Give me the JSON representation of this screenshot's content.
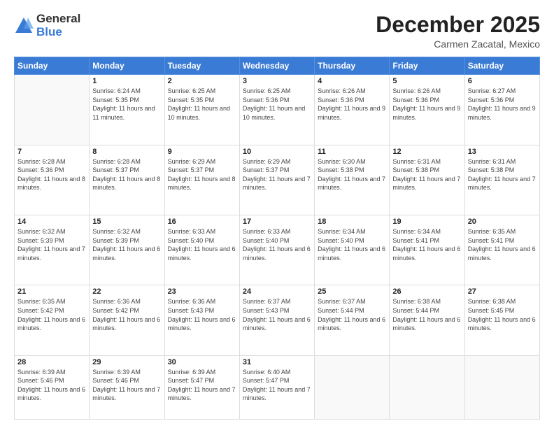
{
  "header": {
    "logo_general": "General",
    "logo_blue": "Blue",
    "main_title": "December 2025",
    "subtitle": "Carmen Zacatal, Mexico"
  },
  "days_of_week": [
    "Sunday",
    "Monday",
    "Tuesday",
    "Wednesday",
    "Thursday",
    "Friday",
    "Saturday"
  ],
  "weeks": [
    [
      {
        "day": "",
        "content": ""
      },
      {
        "day": "1",
        "content": "Sunrise: 6:24 AM\nSunset: 5:35 PM\nDaylight: 11 hours and 11 minutes."
      },
      {
        "day": "2",
        "content": "Sunrise: 6:25 AM\nSunset: 5:35 PM\nDaylight: 11 hours and 10 minutes."
      },
      {
        "day": "3",
        "content": "Sunrise: 6:25 AM\nSunset: 5:36 PM\nDaylight: 11 hours and 10 minutes."
      },
      {
        "day": "4",
        "content": "Sunrise: 6:26 AM\nSunset: 5:36 PM\nDaylight: 11 hours and 9 minutes."
      },
      {
        "day": "5",
        "content": "Sunrise: 6:26 AM\nSunset: 5:36 PM\nDaylight: 11 hours and 9 minutes."
      },
      {
        "day": "6",
        "content": "Sunrise: 6:27 AM\nSunset: 5:36 PM\nDaylight: 11 hours and 9 minutes."
      }
    ],
    [
      {
        "day": "7",
        "content": "Sunrise: 6:28 AM\nSunset: 5:36 PM\nDaylight: 11 hours and 8 minutes."
      },
      {
        "day": "8",
        "content": "Sunrise: 6:28 AM\nSunset: 5:37 PM\nDaylight: 11 hours and 8 minutes."
      },
      {
        "day": "9",
        "content": "Sunrise: 6:29 AM\nSunset: 5:37 PM\nDaylight: 11 hours and 8 minutes."
      },
      {
        "day": "10",
        "content": "Sunrise: 6:29 AM\nSunset: 5:37 PM\nDaylight: 11 hours and 7 minutes."
      },
      {
        "day": "11",
        "content": "Sunrise: 6:30 AM\nSunset: 5:38 PM\nDaylight: 11 hours and 7 minutes."
      },
      {
        "day": "12",
        "content": "Sunrise: 6:31 AM\nSunset: 5:38 PM\nDaylight: 11 hours and 7 minutes."
      },
      {
        "day": "13",
        "content": "Sunrise: 6:31 AM\nSunset: 5:38 PM\nDaylight: 11 hours and 7 minutes."
      }
    ],
    [
      {
        "day": "14",
        "content": "Sunrise: 6:32 AM\nSunset: 5:39 PM\nDaylight: 11 hours and 7 minutes."
      },
      {
        "day": "15",
        "content": "Sunrise: 6:32 AM\nSunset: 5:39 PM\nDaylight: 11 hours and 6 minutes."
      },
      {
        "day": "16",
        "content": "Sunrise: 6:33 AM\nSunset: 5:40 PM\nDaylight: 11 hours and 6 minutes."
      },
      {
        "day": "17",
        "content": "Sunrise: 6:33 AM\nSunset: 5:40 PM\nDaylight: 11 hours and 6 minutes."
      },
      {
        "day": "18",
        "content": "Sunrise: 6:34 AM\nSunset: 5:40 PM\nDaylight: 11 hours and 6 minutes."
      },
      {
        "day": "19",
        "content": "Sunrise: 6:34 AM\nSunset: 5:41 PM\nDaylight: 11 hours and 6 minutes."
      },
      {
        "day": "20",
        "content": "Sunrise: 6:35 AM\nSunset: 5:41 PM\nDaylight: 11 hours and 6 minutes."
      }
    ],
    [
      {
        "day": "21",
        "content": "Sunrise: 6:35 AM\nSunset: 5:42 PM\nDaylight: 11 hours and 6 minutes."
      },
      {
        "day": "22",
        "content": "Sunrise: 6:36 AM\nSunset: 5:42 PM\nDaylight: 11 hours and 6 minutes."
      },
      {
        "day": "23",
        "content": "Sunrise: 6:36 AM\nSunset: 5:43 PM\nDaylight: 11 hours and 6 minutes."
      },
      {
        "day": "24",
        "content": "Sunrise: 6:37 AM\nSunset: 5:43 PM\nDaylight: 11 hours and 6 minutes."
      },
      {
        "day": "25",
        "content": "Sunrise: 6:37 AM\nSunset: 5:44 PM\nDaylight: 11 hours and 6 minutes."
      },
      {
        "day": "26",
        "content": "Sunrise: 6:38 AM\nSunset: 5:44 PM\nDaylight: 11 hours and 6 minutes."
      },
      {
        "day": "27",
        "content": "Sunrise: 6:38 AM\nSunset: 5:45 PM\nDaylight: 11 hours and 6 minutes."
      }
    ],
    [
      {
        "day": "28",
        "content": "Sunrise: 6:39 AM\nSunset: 5:46 PM\nDaylight: 11 hours and 6 minutes."
      },
      {
        "day": "29",
        "content": "Sunrise: 6:39 AM\nSunset: 5:46 PM\nDaylight: 11 hours and 7 minutes."
      },
      {
        "day": "30",
        "content": "Sunrise: 6:39 AM\nSunset: 5:47 PM\nDaylight: 11 hours and 7 minutes."
      },
      {
        "day": "31",
        "content": "Sunrise: 6:40 AM\nSunset: 5:47 PM\nDaylight: 11 hours and 7 minutes."
      },
      {
        "day": "",
        "content": ""
      },
      {
        "day": "",
        "content": ""
      },
      {
        "day": "",
        "content": ""
      }
    ]
  ]
}
